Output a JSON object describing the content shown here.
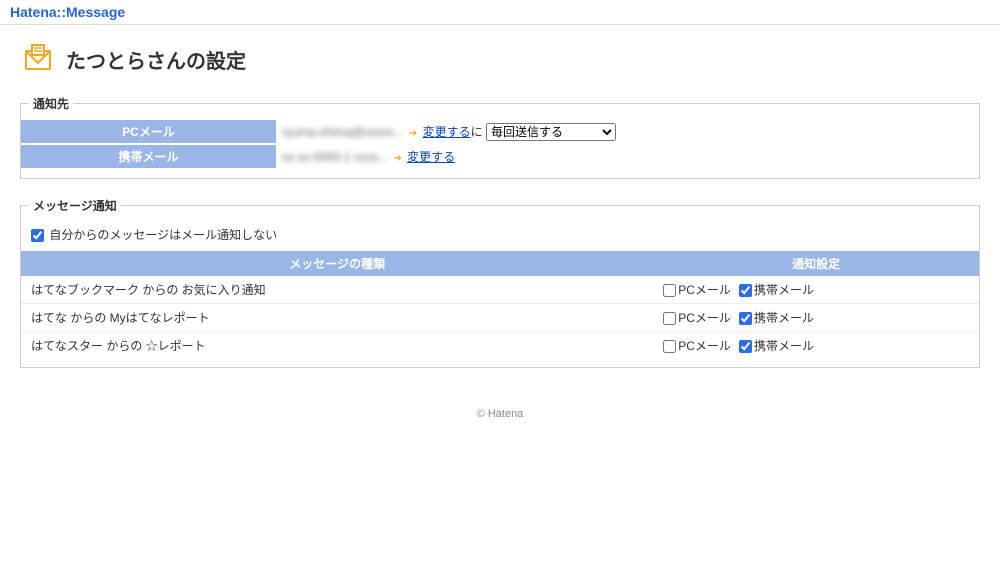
{
  "brand": "Hatena::Message",
  "page_title": "たつとらさんの設定",
  "notification_target": {
    "legend": "通知先",
    "pc_mail": {
      "label": "PCメール",
      "value": "ryuma.ohima@xxxxx...",
      "change": "変更する",
      "suffix": "に",
      "select_value": "毎回送信する"
    },
    "mobile_mail": {
      "label": "携帯メール",
      "value": "xx.xx-0000-1 xxxx...",
      "change": "変更する"
    }
  },
  "message_notify": {
    "legend": "メッセージ通知",
    "self_notify_label": "自分からのメッセージはメール通知しない",
    "self_notify_checked": true,
    "columns": {
      "kind": "メッセージの種類",
      "settings": "通知設定"
    },
    "pc_mail_label": "PCメール",
    "mobile_mail_label": "携帯メール",
    "rows": [
      {
        "kind": "はてなブックマーク からの お気に入り通知",
        "pc": false,
        "mobile": true
      },
      {
        "kind": "はてな からの Myはてなレポート",
        "pc": false,
        "mobile": true
      },
      {
        "kind": "はてなスター からの ☆レポート",
        "pc": false,
        "mobile": true
      }
    ]
  },
  "footer": "© Hatena"
}
